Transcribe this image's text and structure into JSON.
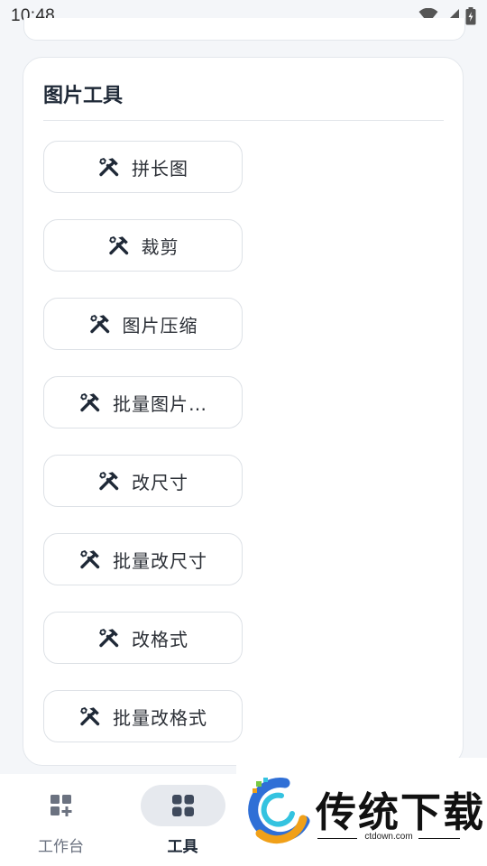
{
  "status_bar": {
    "time": "10:48"
  },
  "card": {
    "title": "图片工具"
  },
  "tools": [
    {
      "label": "拼长图"
    },
    {
      "label": "裁剪"
    },
    {
      "label": "图片压缩"
    },
    {
      "label": "批量图片…"
    },
    {
      "label": "改尺寸"
    },
    {
      "label": "批量改尺寸"
    },
    {
      "label": "改格式"
    },
    {
      "label": "批量改格式"
    }
  ],
  "tool_icon": "hammer-wrench-icon",
  "bottom_nav": {
    "items": [
      {
        "label": "工作台",
        "icon": "dashboard-add-icon",
        "active": false
      },
      {
        "label": "工具",
        "icon": "grid-icon",
        "active": true
      }
    ]
  },
  "watermark": {
    "brand": "传统下载",
    "url": "ctdown.com"
  },
  "colors": {
    "background": "#f4f6f9",
    "card": "#ffffff",
    "active_pill": "#e6e9ee",
    "text": "#1f2937"
  }
}
